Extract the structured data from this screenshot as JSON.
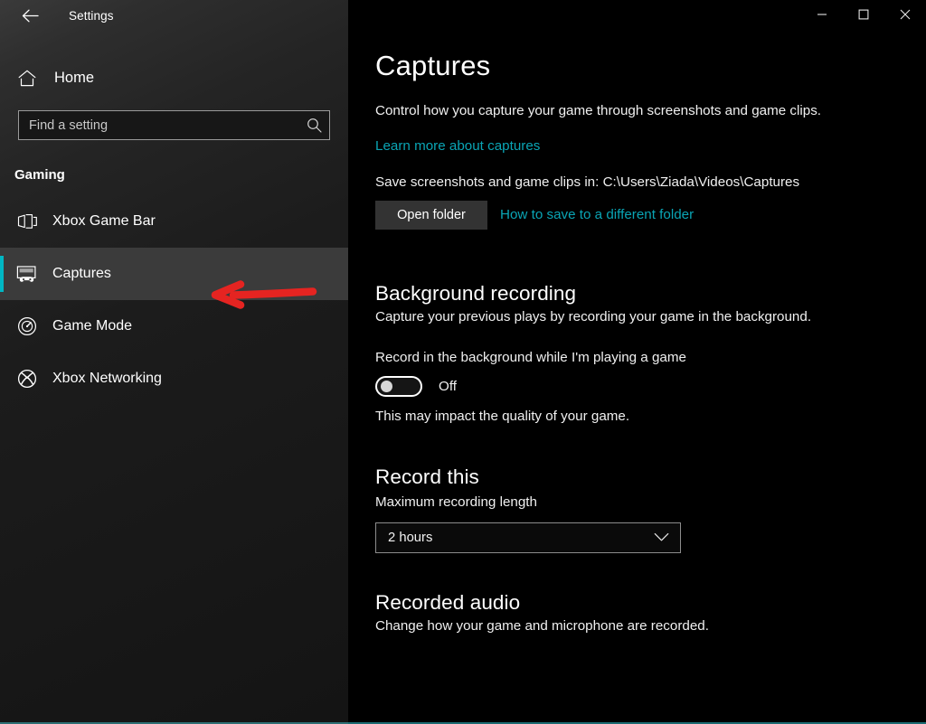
{
  "window": {
    "title": "Settings",
    "back_icon": "back-arrow-icon",
    "controls": {
      "minimize_label": "Minimize",
      "maximize_label": "Maximize",
      "close_label": "Close"
    }
  },
  "sidebar": {
    "home": {
      "label": "Home",
      "icon": "home-icon"
    },
    "search": {
      "placeholder": "Find a setting",
      "value": "",
      "icon": "search-icon"
    },
    "group_header": "Gaming",
    "accent_color": "#00b7c3",
    "items": [
      {
        "label": "Xbox Game Bar",
        "icon": "game-bar-icon",
        "selected": false
      },
      {
        "label": "Captures",
        "icon": "captures-icon",
        "selected": true
      },
      {
        "label": "Game Mode",
        "icon": "game-mode-icon",
        "selected": false
      },
      {
        "label": "Xbox Networking",
        "icon": "xbox-icon",
        "selected": false
      }
    ],
    "annotation": {
      "type": "arrow",
      "color": "#e52421",
      "points_to": "Captures"
    }
  },
  "main": {
    "title": "Captures",
    "intro": "Control how you capture your game through screenshots and game clips.",
    "learn_more_link": "Learn more about captures",
    "save_location_text": "Save screenshots and game clips in: C:\\Users\\Ziada\\Videos\\Captures",
    "open_folder_button": "Open folder",
    "different_folder_link": "How to save to a different folder",
    "link_color": "#0aa5b5",
    "background_recording": {
      "title": "Background recording",
      "subtitle": "Capture your previous plays by recording your game in the background.",
      "toggle_label": "Record in the background while I'm playing a game",
      "toggle_state": "Off",
      "toggle_on": false,
      "note": "This may impact the quality of your game."
    },
    "record_this": {
      "title": "Record this",
      "field_label": "Maximum recording length",
      "selected_value": "2 hours",
      "chevron_icon": "chevron-down-icon"
    },
    "recorded_audio": {
      "title": "Recorded audio",
      "subtitle": "Change how your game and microphone are recorded."
    }
  }
}
